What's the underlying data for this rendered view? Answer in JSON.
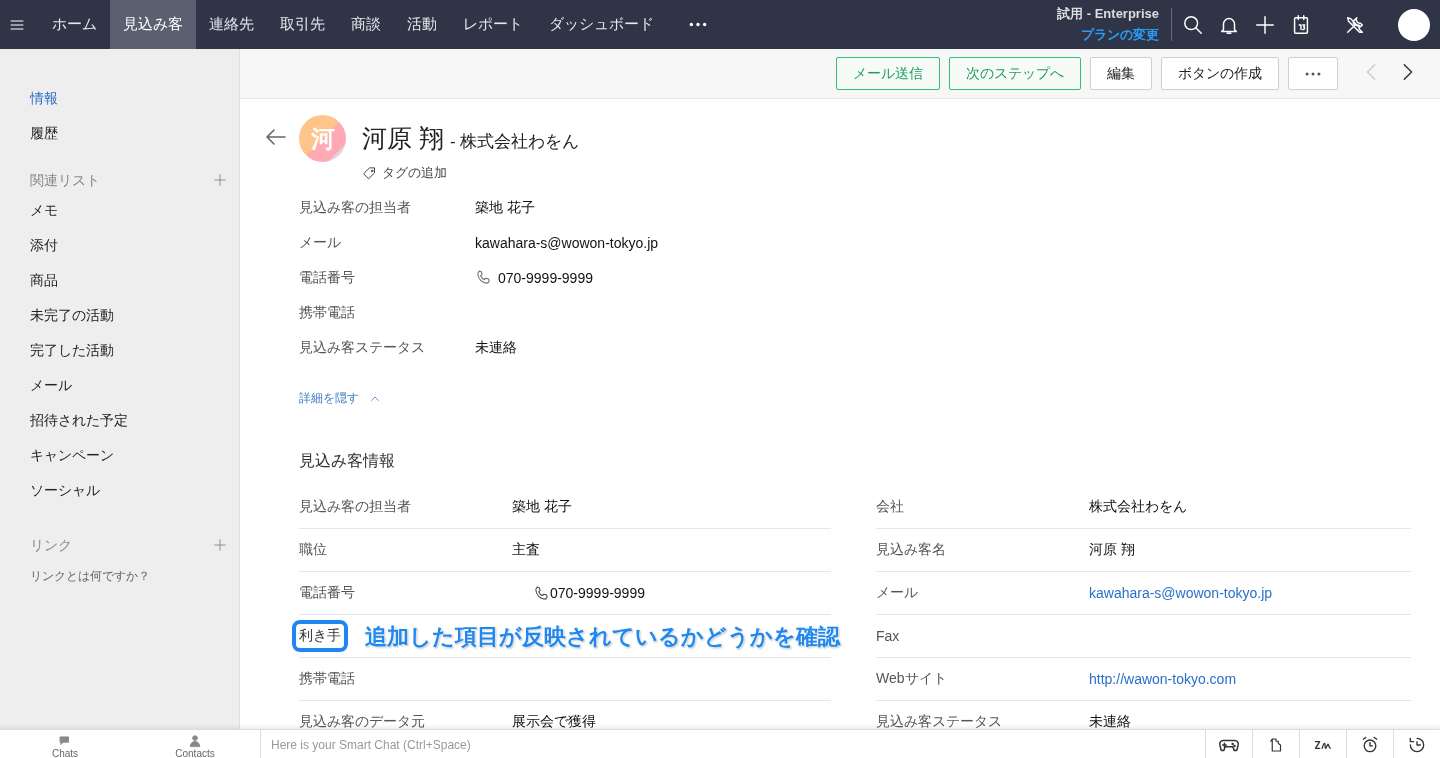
{
  "top_nav": {
    "items": [
      {
        "label": "ホーム",
        "selected": false
      },
      {
        "label": "見込み客",
        "selected": true
      },
      {
        "label": "連絡先",
        "selected": false
      },
      {
        "label": "取引先",
        "selected": false
      },
      {
        "label": "商談",
        "selected": false
      },
      {
        "label": "活動",
        "selected": false
      },
      {
        "label": "レポート",
        "selected": false
      },
      {
        "label": "ダッシュボード",
        "selected": false
      }
    ],
    "plan": {
      "edition": "試用 - Enterprise",
      "link": "プランの変更"
    }
  },
  "sidebar": {
    "items": [
      {
        "label": "情報",
        "selected": true
      },
      {
        "label": "履歴",
        "selected": false
      }
    ],
    "related": {
      "title": "関連リスト",
      "items": [
        "メモ",
        "添付",
        "商品",
        "未完了の活動",
        "完了した活動",
        "メール",
        "招待された予定",
        "キャンペーン",
        "ソーシャル"
      ]
    },
    "links": {
      "title": "リンク",
      "help": "リンクとは何ですか？"
    }
  },
  "toolbar": {
    "buttons": [
      {
        "label": "メール送信",
        "kind": "primary"
      },
      {
        "label": "次のステップへ",
        "kind": "primary"
      },
      {
        "label": "編集",
        "kind": "default"
      },
      {
        "label": "ボタンの作成",
        "kind": "default"
      }
    ],
    "prev": {
      "disabled": true
    },
    "next": {
      "disabled": false
    }
  },
  "record": {
    "avatar": "河",
    "name": "河原 翔",
    "company": "- 株式会社わをん",
    "tag_link": "タグの追加",
    "fields": [
      {
        "label": "見込み客の担当者",
        "value": "築地 花子",
        "kind": "text"
      },
      {
        "label": "メール",
        "value": "kawahara-s@wowon-tokyo.jp",
        "kind": "text"
      },
      {
        "label": "電話番号",
        "value": "070-9999-9999",
        "kind": "phone"
      },
      {
        "label": "携帯電話"
      },
      {
        "label": "見込み客ステータス",
        "value": "未連絡",
        "kind": "text"
      }
    ],
    "toggle": "詳細を隠す"
  },
  "section": {
    "title": "見込み客情報",
    "left": [
      {
        "label": "見込み客の担当者",
        "value": "築地 花子",
        "kind": "text",
        "highlighted": false
      },
      {
        "label": "職位",
        "value": "主査",
        "kind": "text",
        "highlighted": false
      },
      {
        "label": "電話番号",
        "value": "070-9999-9999",
        "kind": "phone",
        "highlighted": false
      },
      {
        "label": "利き手",
        "highlighted": true
      },
      {
        "label": "携帯電話",
        "highlighted": false
      },
      {
        "label": "見込み客のデータ元",
        "value": "展示会で獲得",
        "kind": "text",
        "highlighted": false
      }
    ],
    "right": [
      {
        "label": "会社",
        "value": "株式会社わをん",
        "kind": "text",
        "highlighted": false
      },
      {
        "label": "見込み客名",
        "value": "河原 翔",
        "kind": "text",
        "highlighted": false
      },
      {
        "label": "メール",
        "value": "kawahara-s@wowon-tokyo.jp",
        "kind": "link",
        "highlighted": false
      },
      {
        "label": "Fax",
        "highlighted": false
      },
      {
        "label": "Webサイト",
        "value": "http://wawon-tokyo.com",
        "kind": "link",
        "highlighted": false
      },
      {
        "label": "見込み客ステータス",
        "value": "未連絡",
        "kind": "text",
        "highlighted": false
      }
    ]
  },
  "annotation": {
    "text": "追加した項目が反映されているかどうかを確認"
  },
  "bottom_bar": {
    "tabs": [
      "Chats",
      "Contacts"
    ],
    "chat": {
      "placeholder": "Here is your Smart Chat (Ctrl+Space)"
    }
  }
}
